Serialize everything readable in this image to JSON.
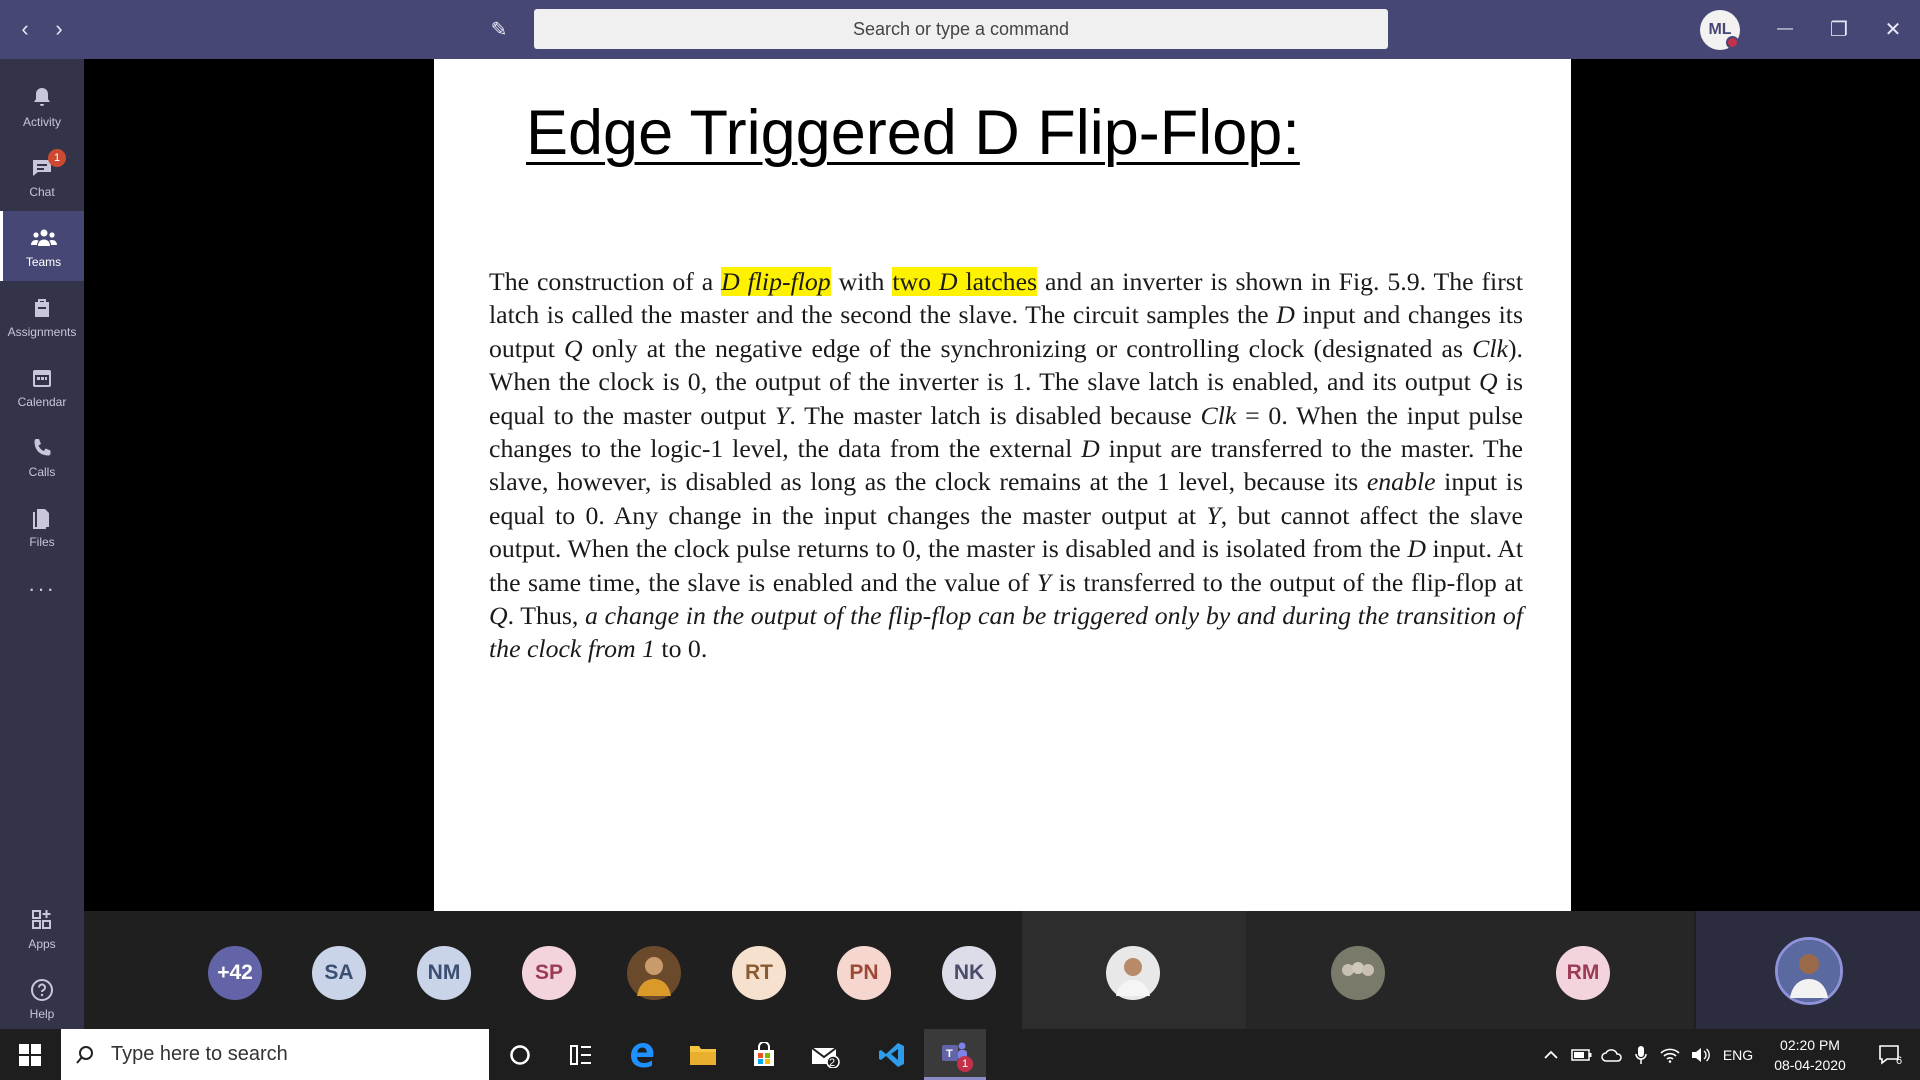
{
  "titlebar": {
    "search_placeholder": "Search or type a command",
    "user_initials": "ML",
    "back_icon": "‹",
    "forward_icon": "›",
    "compose_icon": "✎",
    "minimize_icon": "—",
    "restore_icon": "❐",
    "close_icon": "✕"
  },
  "rail": {
    "items": [
      {
        "label": "Activity",
        "icon": "bell-icon"
      },
      {
        "label": "Chat",
        "icon": "chat-icon",
        "badge": "1"
      },
      {
        "label": "Teams",
        "icon": "teams-icon"
      },
      {
        "label": "Assignments",
        "icon": "assignments-icon"
      },
      {
        "label": "Calendar",
        "icon": "calendar-icon"
      },
      {
        "label": "Calls",
        "icon": "phone-icon"
      },
      {
        "label": "Files",
        "icon": "files-icon"
      }
    ],
    "more": "···",
    "bottom": [
      {
        "label": "Apps",
        "icon": "apps-icon"
      },
      {
        "label": "Help",
        "icon": "help-icon"
      }
    ]
  },
  "slide": {
    "title": "Edge Triggered D Flip-Flop:",
    "p1": "The construction of a ",
    "h1": "D flip-flop",
    "p2": " with ",
    "h2a": "two ",
    "h2b": "D",
    "h2c": " latches",
    "p3": " and an inverter is shown in Fig. 5.9. The first latch is called the master and the second the slave. The circuit samples the ",
    "i_D1": "D",
    "p4": " input and changes its output ",
    "i_Q1": "Q",
    "p5": " only at the negative edge of the synchronizing or controlling clock (designated as ",
    "i_Clk1": "Clk",
    "p6": "). When the clock is 0, the output of the inverter is 1. The slave latch is enabled, and its output ",
    "i_Q2": "Q",
    "p7": " is equal to the master output ",
    "i_Y1": "Y",
    "p8": ". The master latch is disabled because ",
    "i_Clk2": "Clk",
    "p9": " = 0. When the input pulse changes to the logic-1 level, the data from the external ",
    "i_D2": "D",
    "p10": " input are transferred to the master. The slave, however, is disabled as long as the clock remains at the 1 level, because its ",
    "i_enable": "enable",
    "p11": " input is equal to 0. Any change in the input changes the master output at ",
    "i_Y2": "Y",
    "p12": ", but cannot affect the slave output. When the clock pulse returns to 0, the master is disabled and is isolated from the ",
    "i_D3": "D",
    "p13": " input. At the same time, the slave is enabled and the value of ",
    "i_Y3": "Y",
    "p14": " is transferred to the output of the flip-flop at ",
    "i_Q3": "Q",
    "p15": ". Thus, ",
    "i_tail": "a change in the output of the flip-flop can be triggered only by and during the transition of the clock from 1",
    "p16": " to 0."
  },
  "participants": [
    {
      "initials": "+42",
      "bg": "#6264a7",
      "fg": "#ffffff"
    },
    {
      "initials": "SA",
      "bg": "#c9d4e8",
      "fg": "#3b4e74"
    },
    {
      "initials": "NM",
      "bg": "#c9d4e8",
      "fg": "#3b4e74"
    },
    {
      "initials": "SP",
      "bg": "#f4d4dc",
      "fg": "#9c3b55"
    },
    {
      "initials": "",
      "bg": "#7a5a3a",
      "fg": "#ffffff"
    },
    {
      "initials": "RT",
      "bg": "#f6e1cf",
      "fg": "#8a5a30"
    },
    {
      "initials": "PN",
      "bg": "#f6d7cf",
      "fg": "#9c4a35"
    },
    {
      "initials": "NK",
      "bg": "#dcdde8",
      "fg": "#4a4c6a"
    },
    {
      "initials": "",
      "bg": "#d6d6d6",
      "fg": "#333333"
    },
    {
      "initials": "",
      "bg": "#8a8a7a",
      "fg": "#ffffff"
    },
    {
      "initials": "RM",
      "bg": "#f4d4dc",
      "fg": "#9c3b55"
    },
    {
      "initials": "",
      "bg": "#5a6aa0",
      "fg": "#ffffff"
    }
  ],
  "taskbar": {
    "search_placeholder": "Type here to search",
    "mail_badge": "2",
    "teams_badge": "1",
    "lang": "ENG",
    "time": "02:20 PM",
    "date": "08-04-2020",
    "notif_count": "6"
  }
}
